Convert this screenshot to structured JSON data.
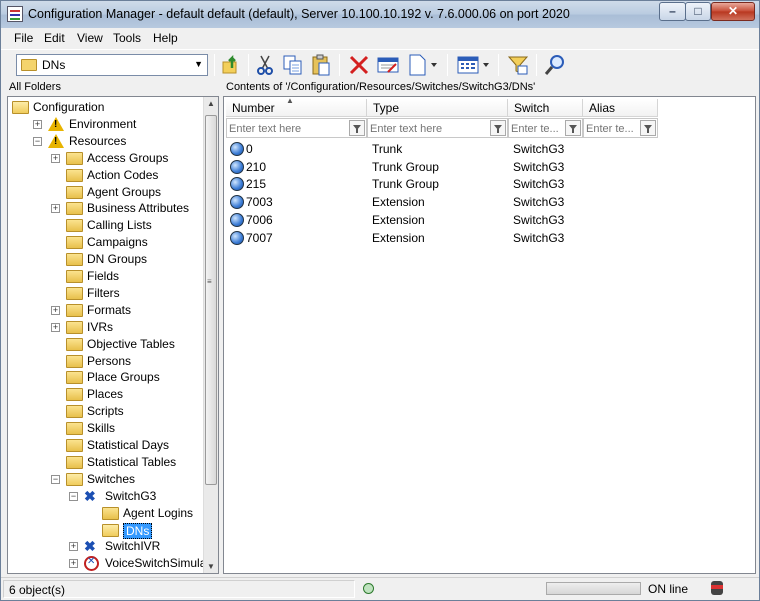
{
  "window": {
    "title": "Configuration Manager - default default (default), Server 10.100.10.192 v. 7.6.000.06 on port 2020"
  },
  "menu": {
    "file": "File",
    "edit": "Edit",
    "view": "View",
    "tools": "Tools",
    "help": "Help"
  },
  "toolbar": {
    "folder_combo_value": "DNs",
    "buttons": [
      "up-one-level",
      "cut",
      "copy",
      "paste",
      "delete",
      "properties",
      "new",
      "view-options",
      "filter",
      "find"
    ]
  },
  "left_panel": {
    "header": "All Folders",
    "tree": [
      {
        "label": "Configuration",
        "icon": "folder-open-icon",
        "expander": "none"
      },
      {
        "label": "Environment",
        "icon": "warning-icon",
        "expander": "+"
      },
      {
        "label": "Resources",
        "icon": "warning-icon",
        "expander": "−"
      },
      {
        "label": "Access Groups",
        "icon": "folder-icon",
        "expander": "+"
      },
      {
        "label": "Action Codes",
        "icon": "folder-icon",
        "expander": "none"
      },
      {
        "label": "Agent Groups",
        "icon": "folder-icon",
        "expander": "none"
      },
      {
        "label": "Business Attributes",
        "icon": "folder-icon",
        "expander": "+"
      },
      {
        "label": "Calling Lists",
        "icon": "folder-icon",
        "expander": "none"
      },
      {
        "label": "Campaigns",
        "icon": "folder-icon",
        "expander": "none"
      },
      {
        "label": "DN Groups",
        "icon": "folder-icon",
        "expander": "none"
      },
      {
        "label": "Fields",
        "icon": "folder-icon",
        "expander": "none"
      },
      {
        "label": "Filters",
        "icon": "folder-icon",
        "expander": "none"
      },
      {
        "label": "Formats",
        "icon": "folder-icon",
        "expander": "+"
      },
      {
        "label": "IVRs",
        "icon": "folder-icon",
        "expander": "+"
      },
      {
        "label": "Objective Tables",
        "icon": "folder-icon",
        "expander": "none"
      },
      {
        "label": "Persons",
        "icon": "folder-icon",
        "expander": "none"
      },
      {
        "label": "Place Groups",
        "icon": "folder-icon",
        "expander": "none"
      },
      {
        "label": "Places",
        "icon": "folder-icon",
        "expander": "none"
      },
      {
        "label": "Scripts",
        "icon": "folder-icon",
        "expander": "none"
      },
      {
        "label": "Skills",
        "icon": "folder-icon",
        "expander": "none"
      },
      {
        "label": "Statistical Days",
        "icon": "folder-icon",
        "expander": "none"
      },
      {
        "label": "Statistical Tables",
        "icon": "folder-icon",
        "expander": "none"
      },
      {
        "label": "Switches",
        "icon": "folder-open-icon",
        "expander": "−"
      },
      {
        "label": "SwitchG3",
        "icon": "switch-icon",
        "expander": "−"
      },
      {
        "label": "Agent Logins",
        "icon": "folder-icon",
        "expander": "none"
      },
      {
        "label": "DNs",
        "icon": "folder-open-icon",
        "expander": "none",
        "selected": true
      },
      {
        "label": "SwitchIVR",
        "icon": "switch-icon",
        "expander": "+"
      },
      {
        "label": "VoiceSwitchSimulation",
        "icon": "voice-switch-icon",
        "expander": "+"
      }
    ]
  },
  "right_panel": {
    "header": "Contents of '/Configuration/Resources/Switches/SwitchG3/DNs'",
    "columns": [
      "Number",
      "Type",
      "Switch",
      "Alias"
    ],
    "filter_placeholders": [
      "Enter text here",
      "Enter text here",
      "Enter te...",
      "Enter te..."
    ],
    "rows": [
      {
        "number": "0",
        "type": "Trunk",
        "switch": "SwitchG3",
        "alias": ""
      },
      {
        "number": "210",
        "type": "Trunk Group",
        "switch": "SwitchG3",
        "alias": ""
      },
      {
        "number": "215",
        "type": "Trunk Group",
        "switch": "SwitchG3",
        "alias": ""
      },
      {
        "number": "7003",
        "type": "Extension",
        "switch": "SwitchG3",
        "alias": ""
      },
      {
        "number": "7006",
        "type": "Extension",
        "switch": "SwitchG3",
        "alias": ""
      },
      {
        "number": "7007",
        "type": "Extension",
        "switch": "SwitchG3",
        "alias": ""
      }
    ]
  },
  "statusbar": {
    "count": "6 object(s)",
    "connection": "ON line"
  }
}
